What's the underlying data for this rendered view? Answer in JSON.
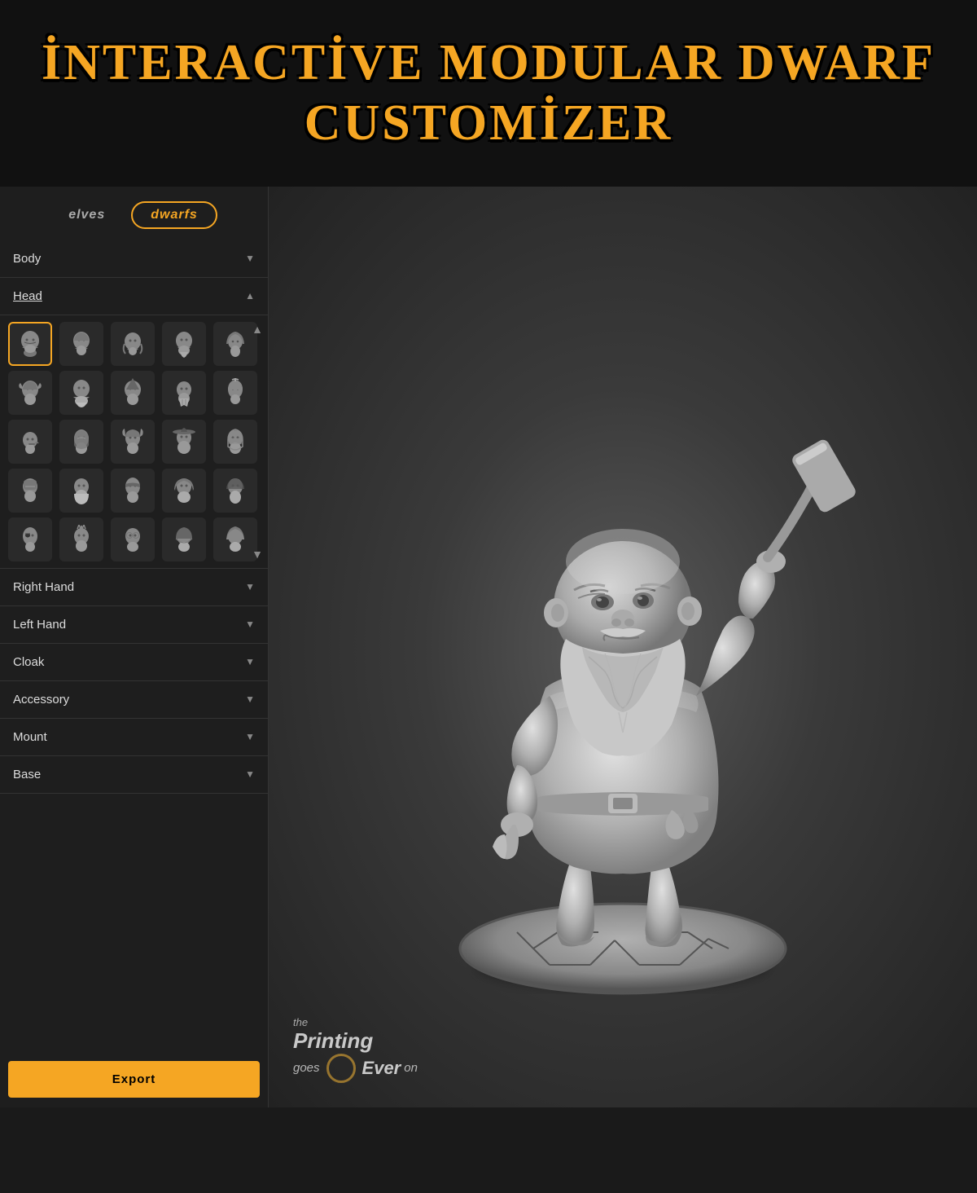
{
  "header": {
    "title_line1": "İNTERACTİVE MODULAR DWARF",
    "title_line2": "CUSTOMİZER"
  },
  "tabs": [
    {
      "id": "elves",
      "label": "elves",
      "active": false
    },
    {
      "id": "dwarfs",
      "label": "dwarfs",
      "active": true
    }
  ],
  "sections": [
    {
      "id": "body",
      "label": "Body",
      "expanded": false,
      "arrow": "▼"
    },
    {
      "id": "head",
      "label": "Head",
      "expanded": true,
      "arrow": "▲"
    },
    {
      "id": "right-hand",
      "label": "Right Hand",
      "expanded": false,
      "arrow": "▼"
    },
    {
      "id": "left-hand",
      "label": "Left Hand",
      "expanded": false,
      "arrow": "▼"
    },
    {
      "id": "cloak",
      "label": "Cloak",
      "expanded": false,
      "arrow": "▼"
    },
    {
      "id": "accessory",
      "label": "Accessory",
      "expanded": false,
      "arrow": "▼"
    },
    {
      "id": "mount",
      "label": "Mount",
      "expanded": false,
      "arrow": "▼"
    },
    {
      "id": "base",
      "label": "Base",
      "expanded": false,
      "arrow": "▼"
    }
  ],
  "head_grid": {
    "count": 25,
    "selected_index": 0
  },
  "export_label": "Export",
  "watermark": {
    "the": "the",
    "printing": "Printing",
    "goes": "goes",
    "ever": "Ever",
    "on": "on"
  },
  "colors": {
    "accent": "#f5a623",
    "bg_dark": "#1e1e1e",
    "bg_medium": "#2a2a2a",
    "text_light": "#ddd",
    "border": "#333"
  }
}
